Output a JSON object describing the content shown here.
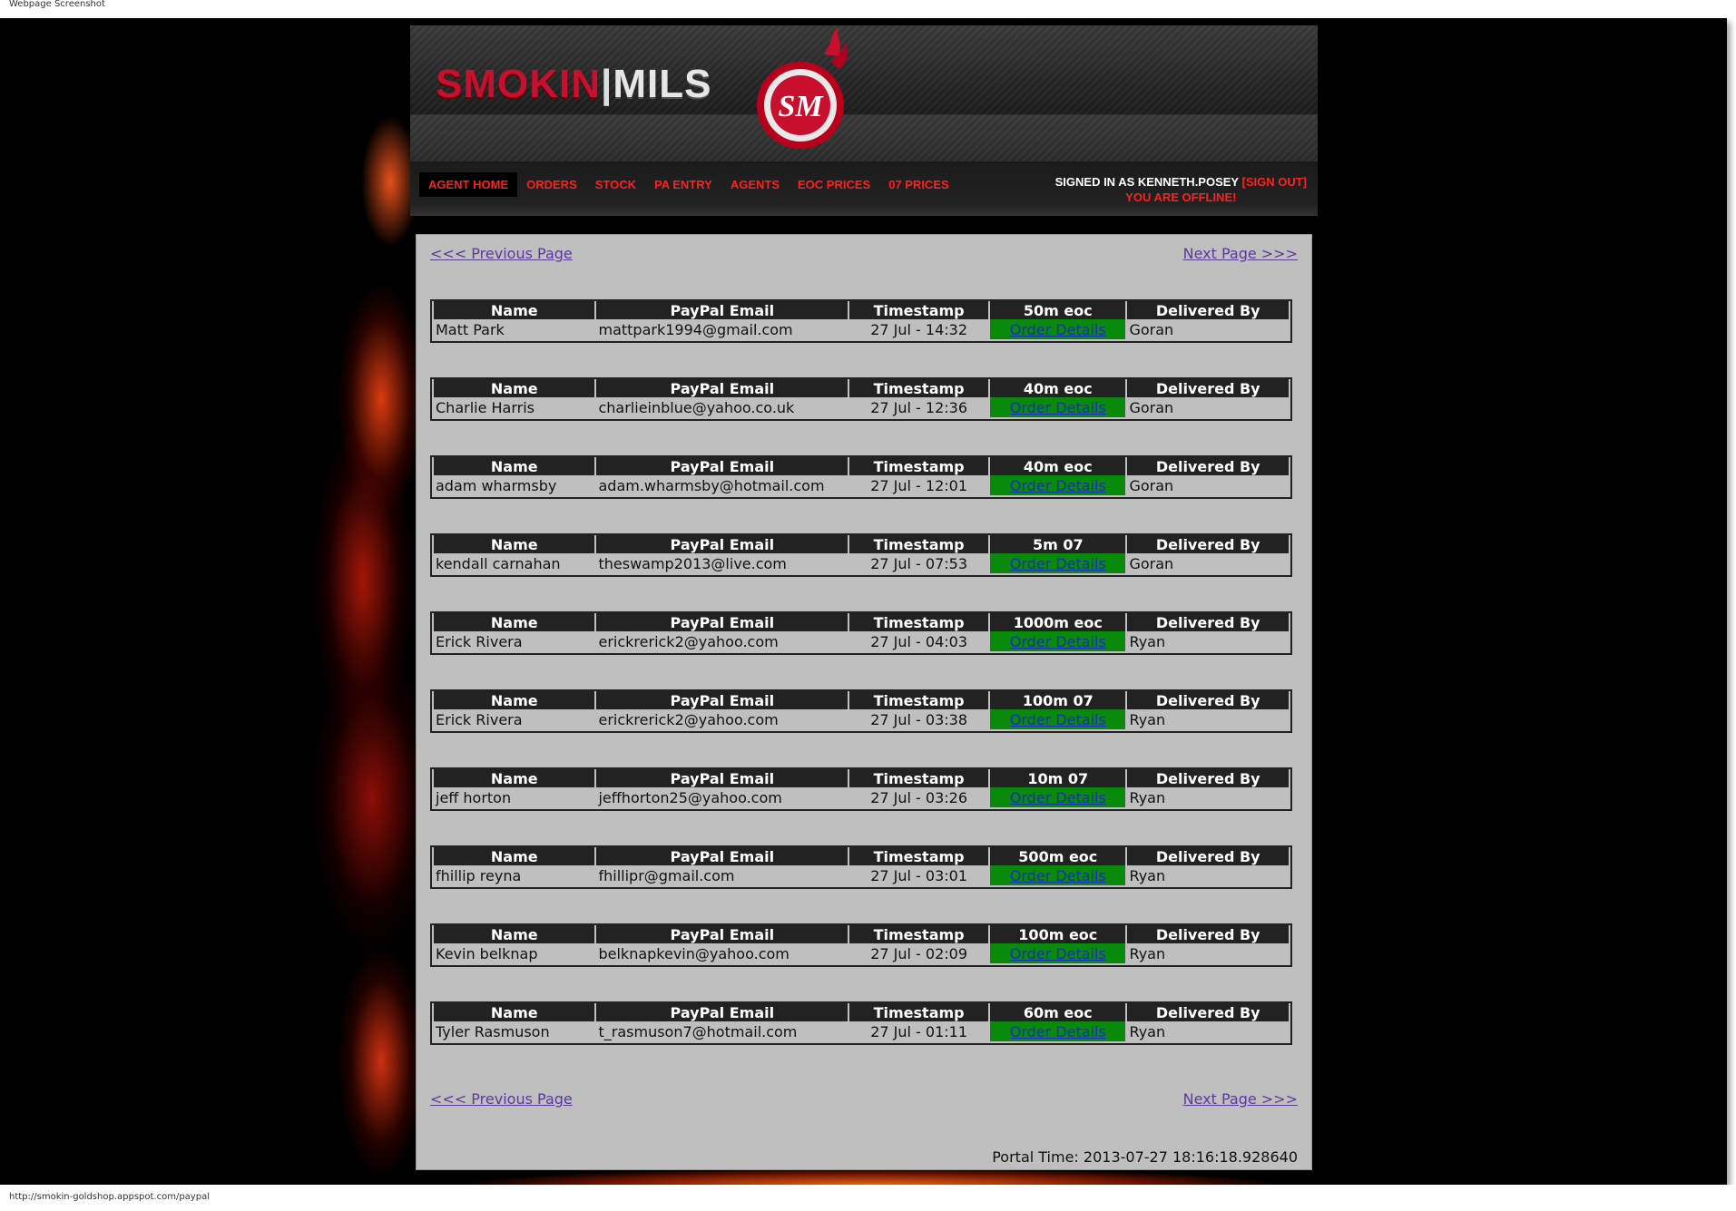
{
  "capture": {
    "title": "Webpage Screenshot",
    "status_url": "http://smokin-goldshop.appspot.com/paypal"
  },
  "logo": {
    "part1": "SMOKIN",
    "separator": "|",
    "part2": "MILS",
    "emblem_text": "SM"
  },
  "nav": {
    "items": [
      "AGENT HOME",
      "ORDERS",
      "STOCK",
      "PA ENTRY",
      "AGENTS",
      "EOC PRICES",
      "07 PRICES"
    ],
    "active": "AGENT HOME"
  },
  "signin": {
    "text": "SIGNED IN AS KENNETH.POSEY",
    "signout": "[SIGN OUT]",
    "status": "YOU ARE OFFLINE!"
  },
  "pager": {
    "prev": "<<< Previous Page",
    "next": "Next Page >>>"
  },
  "columns": {
    "name": "Name",
    "email": "PayPal Email",
    "timestamp": "Timestamp",
    "delivered_by": "Delivered By"
  },
  "order_link_label": "Order Details",
  "orders": [
    {
      "amount": "50m eoc",
      "name": "Matt Park",
      "email": "mattpark1994@gmail.com",
      "timestamp": "27 Jul - 14:32",
      "delivered_by": "Goran"
    },
    {
      "amount": "40m eoc",
      "name": "Charlie Harris",
      "email": "charlieinblue@yahoo.co.uk",
      "timestamp": "27 Jul - 12:36",
      "delivered_by": "Goran"
    },
    {
      "amount": "40m eoc",
      "name": "adam wharmsby",
      "email": "adam.wharmsby@hotmail.com",
      "timestamp": "27 Jul - 12:01",
      "delivered_by": "Goran"
    },
    {
      "amount": "5m 07",
      "name": "kendall carnahan",
      "email": "theswamp2013@live.com",
      "timestamp": "27 Jul - 07:53",
      "delivered_by": "Goran"
    },
    {
      "amount": "1000m eoc",
      "name": "Erick Rivera",
      "email": "erickrerick2@yahoo.com",
      "timestamp": "27 Jul - 04:03",
      "delivered_by": "Ryan"
    },
    {
      "amount": "100m 07",
      "name": "Erick Rivera",
      "email": "erickrerick2@yahoo.com",
      "timestamp": "27 Jul - 03:38",
      "delivered_by": "Ryan"
    },
    {
      "amount": "10m 07",
      "name": "jeff horton",
      "email": "jeffhorton25@yahoo.com",
      "timestamp": "27 Jul - 03:26",
      "delivered_by": "Ryan"
    },
    {
      "amount": "500m eoc",
      "name": "fhillip reyna",
      "email": "fhillipr@gmail.com",
      "timestamp": "27 Jul - 03:01",
      "delivered_by": "Ryan"
    },
    {
      "amount": "100m eoc",
      "name": "Kevin belknap",
      "email": "belknapkevin@yahoo.com",
      "timestamp": "27 Jul - 02:09",
      "delivered_by": "Ryan"
    },
    {
      "amount": "60m eoc",
      "name": "Tyler Rasmuson",
      "email": "t_rasmuson7@hotmail.com",
      "timestamp": "27 Jul - 01:11",
      "delivered_by": "Ryan"
    }
  ],
  "portal_time": "Portal Time: 2013-07-27 18:16:18.928640",
  "colors": {
    "nav_red": "#ff2020",
    "details_green": "#0a8a0a",
    "content_gray": "#bfbfbf",
    "link_purple": "#5a3a9a"
  }
}
